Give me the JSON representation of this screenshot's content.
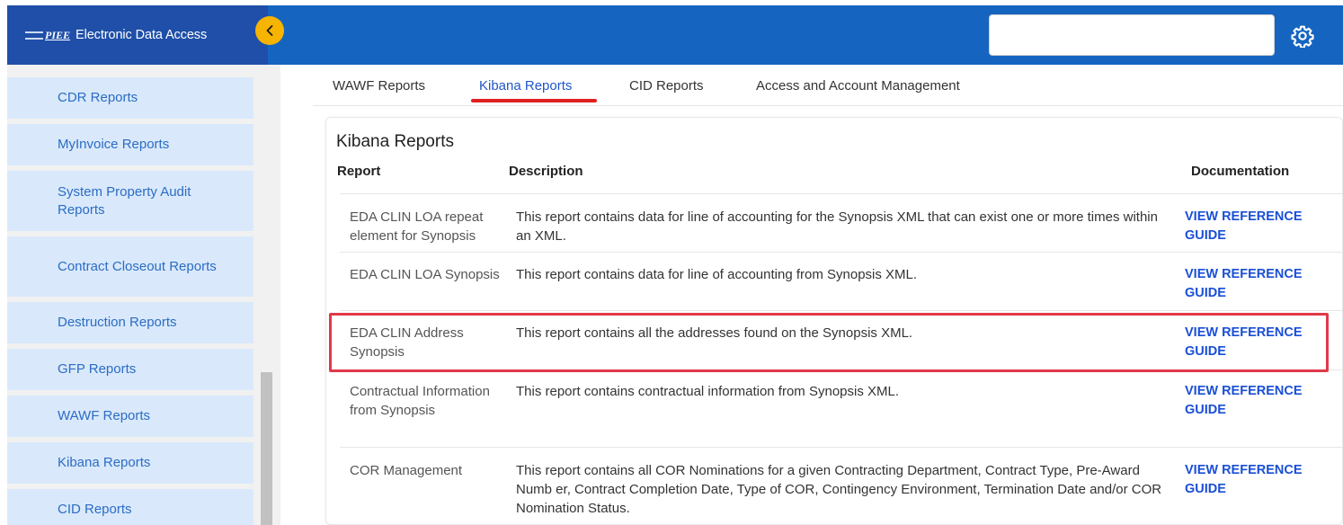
{
  "app": {
    "brand_mark": "PIEE",
    "title": "Electronic Data Access"
  },
  "sidebar": {
    "items": [
      {
        "label": "CDR Reports"
      },
      {
        "label": "MyInvoice Reports"
      },
      {
        "label": "System Property Audit Reports"
      },
      {
        "label": "Contract Closeout Reports"
      },
      {
        "label": "Destruction Reports"
      },
      {
        "label": "GFP Reports"
      },
      {
        "label": "WAWF Reports"
      },
      {
        "label": "Kibana Reports"
      },
      {
        "label": "CID Reports"
      }
    ]
  },
  "topbar": {
    "search_value": ""
  },
  "tabs": [
    {
      "label": "WAWF Reports"
    },
    {
      "label": "Kibana Reports"
    },
    {
      "label": "CID Reports"
    },
    {
      "label": "Access and Account Management"
    }
  ],
  "active_tab": "Kibana Reports",
  "card": {
    "title": "Kibana Reports",
    "headers": {
      "report": "Report",
      "description": "Description",
      "documentation": "Documentation"
    },
    "rows": [
      {
        "report": "EDA CLIN LOA repeat element for Synopsis",
        "description": "This report contains data for line of accounting for the Synopsis XML that can exist one or more times within an XML.",
        "link": "VIEW REFERENCE GUIDE"
      },
      {
        "report": "EDA CLIN LOA Synopsis",
        "description": "This report contains data for line of accounting from Synopsis XML.",
        "link": "VIEW REFERENCE GUIDE"
      },
      {
        "report": "EDA CLIN Address Synopsis",
        "description": "This report contains all the addresses found on the Synopsis XML.",
        "link": "VIEW REFERENCE GUIDE"
      },
      {
        "report": "Contractual Information from Synopsis",
        "description": "This report contains contractual information from Synopsis XML.",
        "link": "VIEW REFERENCE GUIDE"
      },
      {
        "report": "COR Management",
        "description": "This report contains all COR Nominations for a given Contracting Department, Contract Type, Pre-Award Numb er, Contract Completion Date, Type of COR, Contingency Environment, Termination Date and/or COR Nomination Status.",
        "link": "VIEW REFERENCE GUIDE"
      }
    ]
  },
  "colors": {
    "header_blue": "#1565c0",
    "sidebar_header_blue": "#1f4fa8",
    "menu_item_bg": "#d9e9fb",
    "menu_item_text": "#2c6cc4",
    "link_blue": "#1a4fd6",
    "collapse_yellow": "#f6b400",
    "highlight_red": "#e0394a"
  }
}
